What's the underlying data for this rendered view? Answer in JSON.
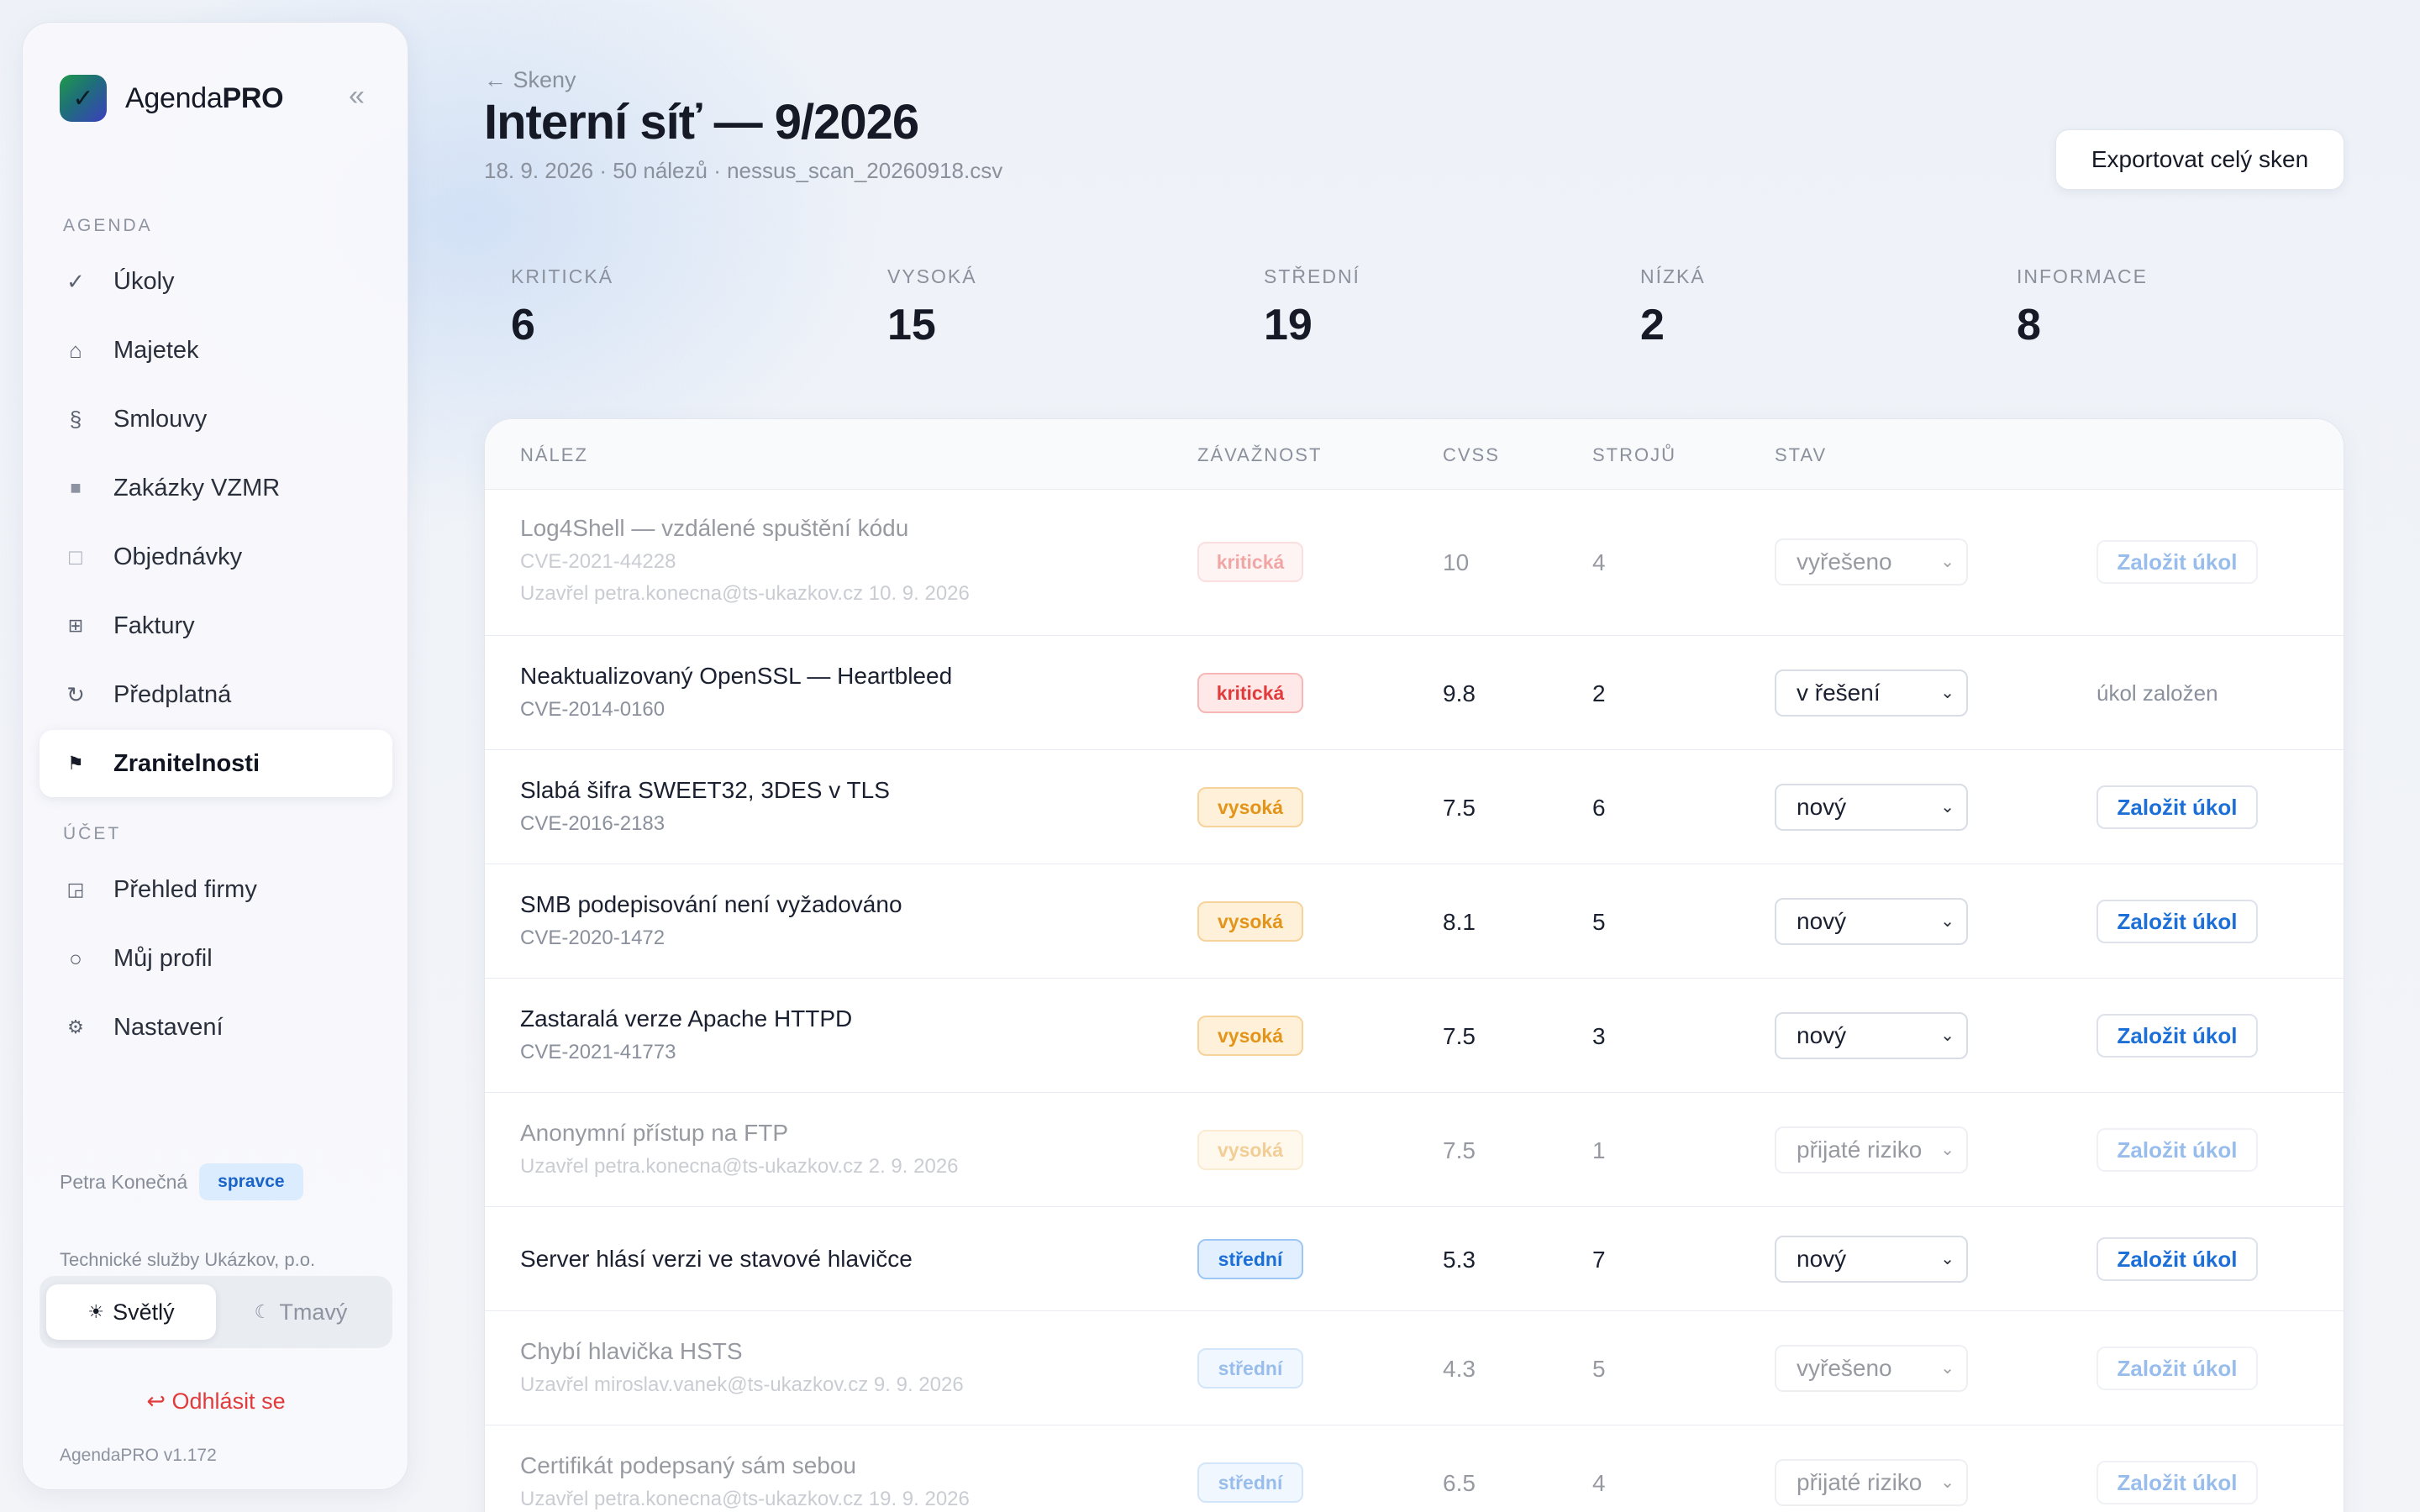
{
  "app": {
    "name_regular": "Agenda",
    "name_bold": "PRO",
    "collapse_icon": "«"
  },
  "sidebar": {
    "section_agenda": "AGENDA",
    "section_account": "ÚČET",
    "items": [
      {
        "label": "Úkoly",
        "icon": "✓"
      },
      {
        "label": "Majetek",
        "icon": "⌂"
      },
      {
        "label": "Smlouvy",
        "icon": "§"
      },
      {
        "label": "Zakázky VZMR",
        "icon": "■"
      },
      {
        "label": "Objednávky",
        "icon": "□"
      },
      {
        "label": "Faktury",
        "icon": "⊞"
      },
      {
        "label": "Předplatná",
        "icon": "↻"
      },
      {
        "label": "Zranitelnosti",
        "icon": "⚑"
      }
    ],
    "account_items": [
      {
        "label": "Přehled firmy",
        "icon": "◲"
      },
      {
        "label": "Můj profil",
        "icon": "○"
      },
      {
        "label": "Nastavení",
        "icon": "⚙"
      }
    ],
    "user_name": "Petra Konečná",
    "role": "spravce",
    "org": "Technické služby Ukázkov, p.o.",
    "theme_light": "Světlý",
    "theme_dark": "Tmavý",
    "theme_light_icon": "☀",
    "theme_dark_icon": "☾",
    "logout": "↩ Odhlásit se",
    "version": "AgendaPRO v1.172"
  },
  "header": {
    "back": "← Skeny",
    "title": "Interní síť — 9/2026",
    "subtitle": "18. 9. 2026 · 50 nálezů · nessus_scan_20260918.csv",
    "export": "Exportovat celý sken"
  },
  "stats": [
    {
      "label": "KRITICKÁ",
      "value": "6"
    },
    {
      "label": "VYSOKÁ",
      "value": "15"
    },
    {
      "label": "STŘEDNÍ",
      "value": "19"
    },
    {
      "label": "NÍZKÁ",
      "value": "2"
    },
    {
      "label": "INFORMACE",
      "value": "8"
    }
  ],
  "table": {
    "columns": [
      "NÁLEZ",
      "ZÁVAŽNOST",
      "CVSS",
      "STROJŮ",
      "STAV"
    ],
    "task_button": "Založit úkol",
    "task_done": "úkol založen",
    "rows": [
      {
        "title": "Log4Shell — vzdálené spuštění kódu",
        "cve": "CVE-2021-44228",
        "closed": "Uzavřel petra.konecna@ts-ukazkov.cz 10. 9. 2026",
        "severity": "kritická",
        "cvss": "10",
        "hosts": "4",
        "status": "vyřešeno"
      },
      {
        "title": "Neaktualizovaný OpenSSL — Heartbleed",
        "cve": "CVE-2014-0160",
        "closed": "",
        "severity": "kritická",
        "cvss": "9.8",
        "hosts": "2",
        "status": "v řešení"
      },
      {
        "title": "Slabá šifra SWEET32, 3DES v TLS",
        "cve": "CVE-2016-2183",
        "closed": "",
        "severity": "vysoká",
        "cvss": "7.5",
        "hosts": "6",
        "status": "nový"
      },
      {
        "title": "SMB podepisování není vyžadováno",
        "cve": "CVE-2020-1472",
        "closed": "",
        "severity": "vysoká",
        "cvss": "8.1",
        "hosts": "5",
        "status": "nový"
      },
      {
        "title": "Zastaralá verze Apache HTTPD",
        "cve": "CVE-2021-41773",
        "closed": "",
        "severity": "vysoká",
        "cvss": "7.5",
        "hosts": "3",
        "status": "nový"
      },
      {
        "title": "Anonymní přístup na FTP",
        "cve": "",
        "closed": "Uzavřel petra.konecna@ts-ukazkov.cz 2. 9. 2026",
        "severity": "vysoká",
        "cvss": "7.5",
        "hosts": "1",
        "status": "přijaté riziko"
      },
      {
        "title": "Server hlásí verzi ve stavové hlavičce",
        "cve": "",
        "closed": "",
        "severity": "střední",
        "cvss": "5.3",
        "hosts": "7",
        "status": "nový"
      },
      {
        "title": "Chybí hlavička HSTS",
        "cve": "",
        "closed": "Uzavřel miroslav.vanek@ts-ukazkov.cz 9. 9. 2026",
        "severity": "střední",
        "cvss": "4.3",
        "hosts": "5",
        "status": "vyřešeno"
      },
      {
        "title": "Certifikát podepsaný sám sebou",
        "cve": "",
        "closed": "Uzavřel petra.konecna@ts-ukazkov.cz 19. 9. 2026",
        "severity": "střední",
        "cvss": "6.5",
        "hosts": "4",
        "status": "přijaté riziko"
      }
    ]
  }
}
